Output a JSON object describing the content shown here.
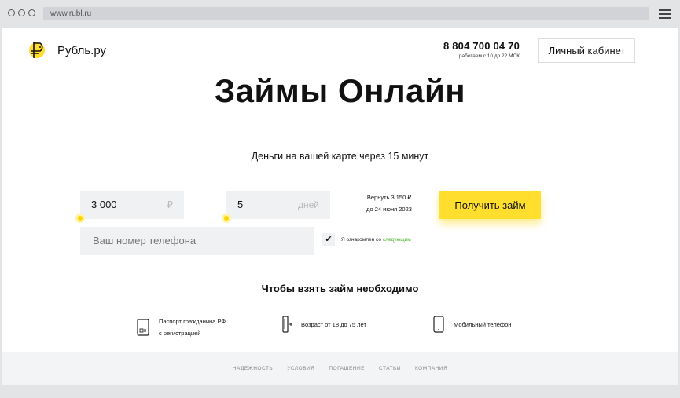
{
  "browser": {
    "url": "www.rubl.ru"
  },
  "header": {
    "logo_text": "Рубль.ру",
    "phone": "8 804 700 04 70",
    "hours": "работаем с 10 до 22 МСК",
    "cabinet_label": "Личный кабинет"
  },
  "hero": {
    "title": "Займы Онлайн",
    "subtitle": "Деньги на вашей карте через 15 минут"
  },
  "form": {
    "amount_value": "3 000",
    "amount_unit": "₽",
    "days_value": "5",
    "days_unit": "дней",
    "return_line1": "Вернуть 3 150 ₽",
    "return_line2": "до 24 июня 2023",
    "submit_label": "Получить займ",
    "phone_placeholder": "Ваш номер телефона",
    "checkbox_mark": "✔",
    "agree_text": "Я ознакомлен со",
    "agree_link": "следующим"
  },
  "requirements": {
    "title": "Чтобы взять займ необходимо",
    "items": [
      {
        "icon": "passport-icon",
        "line1": "Паспорт гражданина РФ",
        "line2": "с регистрацией"
      },
      {
        "icon": "age-icon",
        "line1": "Возраст от 18 до 75 лет",
        "line2": ""
      },
      {
        "icon": "mobile-phone-icon",
        "line1": "Мобильный телефон",
        "line2": ""
      }
    ]
  },
  "footer": {
    "links": [
      "НАДЕЖНОСТЬ",
      "УСЛОВИЯ",
      "ПОГАШЕНИЕ",
      "СТАТЬИ",
      "КОМПАНИЯ"
    ]
  },
  "colors": {
    "accent": "#ffde2e",
    "link": "#4caf2a"
  }
}
